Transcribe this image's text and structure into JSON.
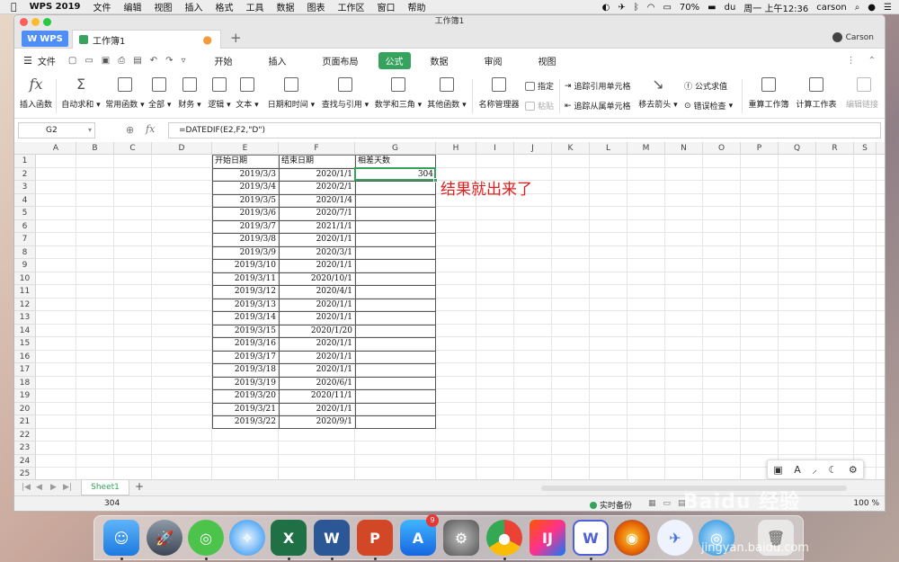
{
  "menubar": {
    "app_name": "WPS 2019",
    "items": [
      "文件",
      "编辑",
      "视图",
      "插入",
      "格式",
      "工具",
      "数据",
      "图表",
      "工作区",
      "窗口",
      "帮助"
    ],
    "battery": "70%",
    "clock": "周一 上午12:36",
    "user": "carson"
  },
  "window": {
    "title": "工作簿1",
    "wps_tab": "WPS",
    "doc_tab": "工作簿1",
    "user": "Carson"
  },
  "menu_row": {
    "file": "文件",
    "tabs": [
      "开始",
      "插入",
      "页面布局",
      "公式",
      "数据",
      "审阅",
      "视图"
    ],
    "active_tab": "公式"
  },
  "ribbon": {
    "insert_fn": "插入函数",
    "autosum": "自动求和",
    "common_fn": "常用函数",
    "all": "全部",
    "finance": "财务",
    "logic": "逻辑",
    "text": "文本",
    "datetime": "日期和时间",
    "lookup": "查找与引用",
    "math": "数学和三角",
    "other_fn": "其他函数",
    "name_mgr": "名称管理器",
    "assign": "指定",
    "paste": "粘贴",
    "trace_pre": "追踪引用单元格",
    "trace_dep": "追踪从属单元格",
    "remove_arrows": "移去箭头",
    "eval_formula": "公式求值",
    "error_check": "错误检查",
    "recalc": "重算工作簿",
    "calc_sheet": "计算工作表",
    "edit_links": "编辑链接"
  },
  "formula_bar": {
    "cell_ref": "G2",
    "formula": "=DATEDIF(E2,F2,\"D\")"
  },
  "columns": [
    "A",
    "B",
    "C",
    "D",
    "E",
    "F",
    "G",
    "H",
    "I",
    "J",
    "K",
    "L",
    "M",
    "N",
    "O",
    "P",
    "Q",
    "R",
    "S"
  ],
  "rows": [
    "1",
    "2",
    "3",
    "4",
    "5",
    "6",
    "7",
    "8",
    "9",
    "10",
    "11",
    "12",
    "13",
    "14",
    "15",
    "16",
    "17",
    "18",
    "19",
    "20",
    "21",
    "22",
    "23",
    "24",
    "25"
  ],
  "table": {
    "headers": [
      "开始日期",
      "结束日期",
      "相差天数"
    ],
    "start_dates": [
      "2019/3/3",
      "2019/3/4",
      "2019/3/5",
      "2019/3/6",
      "2019/3/7",
      "2019/3/8",
      "2019/3/9",
      "2019/3/10",
      "2019/3/11",
      "2019/3/12",
      "2019/3/13",
      "2019/3/14",
      "2019/3/15",
      "2019/3/16",
      "2019/3/17",
      "2019/3/18",
      "2019/3/19",
      "2019/3/20",
      "2019/3/21",
      "2019/3/22"
    ],
    "end_dates": [
      "2020/1/1",
      "2020/2/1",
      "2020/1/4",
      "2020/7/1",
      "2021/1/1",
      "2020/1/1",
      "2020/3/1",
      "2020/1/1",
      "2020/10/1",
      "2020/4/1",
      "2020/1/1",
      "2020/1/1",
      "2020/1/20",
      "2020/1/1",
      "2020/1/1",
      "2020/1/1",
      "2020/6/1",
      "2020/11/1",
      "2020/1/1",
      "2020/9/1"
    ],
    "result": "304"
  },
  "annotation": "结果就出来了",
  "sheet_tab": "Sheet1",
  "status": {
    "value": "304",
    "backup": "实时备份",
    "zoom": "100 %"
  },
  "dock_badge": "9",
  "watermark": "Baidu 经验",
  "watermark_url": "jingyan.baidu.com",
  "colors": {
    "accent": "#35a35d",
    "wps_blue": "#4f8ef7",
    "annotation_red": "#e21c1c"
  }
}
